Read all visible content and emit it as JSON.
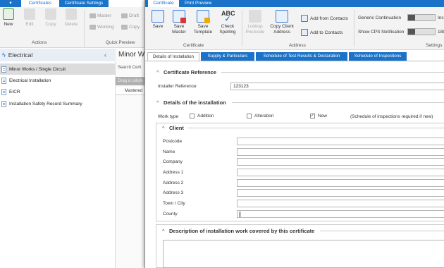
{
  "bg": {
    "tabs": [
      "Certificates",
      "Certificate Settings"
    ],
    "ribbon": {
      "new": "New",
      "edit": "Edit",
      "copy": "Copy",
      "delete": "Delete",
      "actions_label": "Actions",
      "master": "Master",
      "draft": "Draft",
      "working": "Working",
      "copy2": "Copy",
      "quick_preview_label": "Quick Preview"
    },
    "left_panel": {
      "title": "Electrical",
      "collapse": "‹",
      "items": [
        "Minor Works / Single Circuit",
        "Electrical Installation",
        "EICR",
        "Installation Safety Record Summary"
      ]
    },
    "middle": {
      "title": "Minor W",
      "search": "Search Certi",
      "group_hint": "Drag a colum",
      "column": "Mastered"
    }
  },
  "dialog": {
    "tabs": [
      "Certificate",
      "Print Preview"
    ],
    "ribbon": {
      "save": "Save",
      "save_master": [
        "Save",
        "Master"
      ],
      "save_template": [
        "Save",
        "Template"
      ],
      "check_spelling": [
        "Check",
        "Spelling"
      ],
      "abc": "ABC",
      "certificate_label": "Certificate",
      "lookup_postcode": [
        "Lookup",
        "Postcode"
      ],
      "copy_client_address": [
        "Copy Client",
        "Address"
      ],
      "add_from_contacts": "Add from Contacts",
      "add_to_contacts": "Add to Contacts",
      "address_label": "Address",
      "generic_continuation": "Generic Continuation",
      "generic_continuation_value": "Inc",
      "show_cps": "Show CPS Notification",
      "show_cps_value": "18t",
      "settings_label": "Settings"
    },
    "section_tabs": [
      "Details of Installation",
      "Supply & Particulars",
      "Schedule of Test Results & Declaration",
      "Schedule of Inspections"
    ],
    "certificate_reference": {
      "title": "Certificate Reference",
      "installer_reference_label": "Installer Reference",
      "installer_reference_value": "123123"
    },
    "details": {
      "title": "Details of the installation",
      "work_type_label": "Work type",
      "addition": "Addition",
      "alteration": "Alteration",
      "new": "New",
      "new_checked": "✓",
      "note": "(Schedule of inspections required if new)"
    },
    "client": {
      "title": "Client",
      "fields": [
        "Postcode",
        "Name",
        "Company",
        "Address 1",
        "Address 2",
        "Address 3",
        "Town / City",
        "County"
      ]
    },
    "description": {
      "title": "Description of installation work covered by this certificate"
    },
    "colors": {
      "accent": "#1a73c8",
      "ribbon": "#f3f3f3"
    }
  }
}
